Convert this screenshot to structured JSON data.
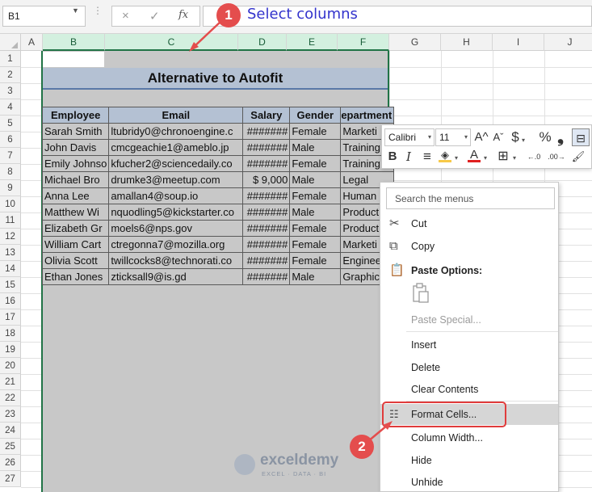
{
  "formula_bar": {
    "name_box": "B1",
    "cancel_icon": "×",
    "enter_icon": "✓",
    "fx_label": "fx",
    "formula": ""
  },
  "columns": [
    "A",
    "B",
    "C",
    "D",
    "E",
    "F",
    "G",
    "H",
    "I",
    "J"
  ],
  "rows": [
    "1",
    "2",
    "3",
    "4",
    "5",
    "6",
    "7",
    "8",
    "9",
    "10",
    "11",
    "12",
    "13",
    "14",
    "15",
    "16",
    "17",
    "18",
    "19",
    "20",
    "21",
    "22",
    "23",
    "24",
    "25",
    "26",
    "27"
  ],
  "sheet": {
    "title": "Alternative to Autofit",
    "headers": [
      "Employee",
      "Email",
      "Salary",
      "Gender",
      "epartment"
    ],
    "data": [
      [
        "Sarah Smith",
        "ltubridy0@chronoengine.c",
        "#######",
        "Female",
        "Marketi"
      ],
      [
        "John Davis",
        "cmcgeachie1@ameblo.jp",
        "#######",
        "Male",
        "Training"
      ],
      [
        "Emily Johnso",
        "kfucher2@sciencedaily.co",
        "#######",
        "Female",
        "Training"
      ],
      [
        "Michael Bro",
        "drumke3@meetup.com",
        "$ 9,000",
        "Male",
        "Legal"
      ],
      [
        "Anna Lee",
        "amallan4@soup.io",
        "#######",
        "Female",
        "Human"
      ],
      [
        "Matthew Wi",
        "nquodling5@kickstarter.co",
        "#######",
        "Male",
        "Product"
      ],
      [
        "Elizabeth Gr",
        "moels6@nps.gov",
        "#######",
        "Female",
        "Product"
      ],
      [
        "William Cart",
        "ctregonna7@mozilla.org",
        "#######",
        "Female",
        "Marketi"
      ],
      [
        "Olivia Scott",
        "twillcocks8@technorati.co",
        "#######",
        "Female",
        "Enginee"
      ],
      [
        "Ethan Jones",
        "zticksall9@is.gd",
        "#######",
        "Male",
        "Graphic"
      ]
    ]
  },
  "annotations": {
    "step1_number": "1",
    "step1_text": "Select columns",
    "step2_number": "2"
  },
  "mini_toolbar": {
    "font_name": "Calibri",
    "font_size": "11",
    "grow_font": "A^",
    "shrink_font": "Aˇ",
    "currency": "$",
    "percent": "%",
    "comma": "❟",
    "bold": "B",
    "italic": "I",
    "align": "≡",
    "fill_letter": "◈",
    "font_color_letter": "A",
    "borders": "⊞",
    "increase_decimal": ".0",
    "decrease_decimal": ".00",
    "format_painter": "🖌",
    "fill_color": "#f7c948",
    "font_color": "#e02020",
    "dropdown": "▾"
  },
  "context_menu": {
    "search_placeholder": "Search the menus",
    "items": {
      "cut": "Cut",
      "copy": "Copy",
      "paste_options": "Paste Options:",
      "paste_special": "Paste Special...",
      "insert": "Insert",
      "delete": "Delete",
      "clear_contents": "Clear Contents",
      "format_cells": "Format Cells...",
      "column_width": "Column Width...",
      "hide": "Hide",
      "unhide": "Unhide"
    }
  },
  "watermark": {
    "name": "exceldemy",
    "tagline": "EXCEL · DATA · BI"
  }
}
